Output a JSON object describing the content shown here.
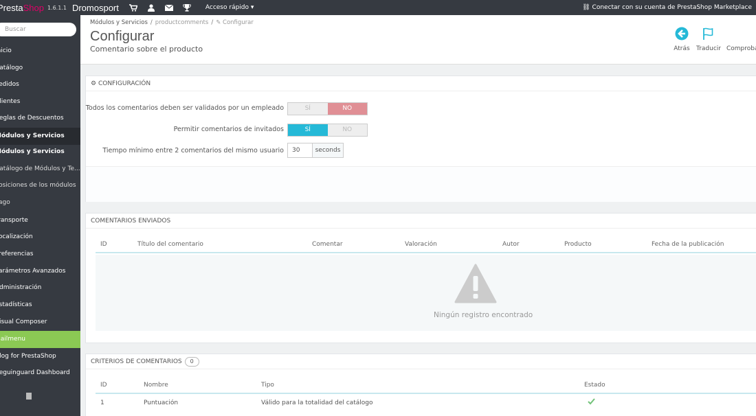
{
  "topbar": {
    "logo_part1": "Presta",
    "logo_part2": "Shop",
    "version": "1.6.1.1",
    "shop_name": "Dromosport",
    "quick_access": "Acceso rápido",
    "marketplace": "Conectar con su cuenta de PrestaShop Marketplace"
  },
  "sidebar": {
    "search_placeholder": "Buscar",
    "items": [
      {
        "label": "Inicio"
      },
      {
        "label": "Catálogo"
      },
      {
        "label": "Pedidos"
      },
      {
        "label": "Clientes"
      },
      {
        "label": "Reglas de Descuentos"
      },
      {
        "label": "Módulos y Servicios"
      },
      {
        "label": "Módulos y Servicios"
      },
      {
        "label": "Catálogo de Módulos y Te..."
      },
      {
        "label": "Posiciones de los módulos"
      },
      {
        "label": "Pago"
      },
      {
        "label": "Transporte"
      },
      {
        "label": "Localización"
      },
      {
        "label": "Preferencias"
      },
      {
        "label": "Parámetros Avanzados"
      },
      {
        "label": "Administración"
      },
      {
        "label": "Estadísticas"
      },
      {
        "label": "Visual Composer"
      },
      {
        "label": "Mailmenu"
      },
      {
        "label": "Blog for PrestaShop"
      },
      {
        "label": "Seguinguard Dashboard"
      }
    ]
  },
  "header": {
    "breadcrumb": [
      "Módulos y Servicios",
      "productcomments",
      "Configurar"
    ],
    "title": "Configurar",
    "subtitle": "Comentario sobre el producto",
    "toolbar": {
      "back": "Atrás",
      "translate": "Traducir",
      "check": "Comproba"
    }
  },
  "config": {
    "heading": "CONFIGURACIÓN",
    "fields": [
      {
        "label": "Todos los comentarios deben ser validados por un empleado",
        "yes": "SÍ",
        "no": "NO",
        "value": "no"
      },
      {
        "label": "Permitir comentarios de invitados",
        "yes": "SÍ",
        "no": "NO",
        "value": "yes"
      }
    ],
    "min_time": {
      "label": "Tiempo mínimo entre 2 comentarios del mismo usuario",
      "value": "30",
      "unit": "seconds"
    }
  },
  "sent_comments": {
    "heading": "COMENTARIOS ENVIADOS",
    "columns": [
      "ID",
      "Título del comentario",
      "Comentar",
      "Valoración",
      "Autor",
      "Producto",
      "Fecha de la publicación"
    ],
    "empty_text": "Ningún registro encontrado"
  },
  "criteria": {
    "heading": "CRITERIOS DE COMENTARIOS",
    "count": "0",
    "columns": [
      "ID",
      "Nombre",
      "Tipo",
      "Estado"
    ],
    "rows": [
      {
        "id": "1",
        "name": "Puntuación",
        "type": "Válido para la totalidad del catálogo",
        "status": "active"
      }
    ]
  },
  "colors": {
    "accent": "#25b9d7",
    "danger": "#e08f95",
    "success": "#72c279",
    "sidebar": "#363a41",
    "highlight": "#8bc954"
  }
}
